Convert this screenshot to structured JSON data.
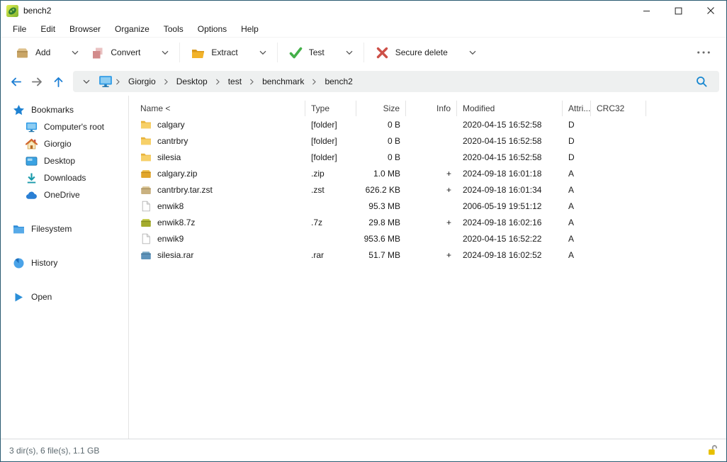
{
  "window": {
    "title": "bench2",
    "app_icon": "peazip-logo-icon",
    "controls": [
      {
        "name": "minimize",
        "icon": "minimize-icon"
      },
      {
        "name": "maximize",
        "icon": "maximize-icon"
      },
      {
        "name": "close",
        "icon": "close-icon"
      }
    ]
  },
  "menu": {
    "items": [
      "File",
      "Edit",
      "Browser",
      "Organize",
      "Tools",
      "Options",
      "Help"
    ]
  },
  "toolbar": {
    "buttons": [
      {
        "label": "Add",
        "icon": "add-archive-icon",
        "separator_after": false
      },
      {
        "label": "Convert",
        "icon": "convert-icon",
        "separator_after": true
      },
      {
        "label": "Extract",
        "icon": "extract-folder-icon",
        "separator_after": true
      },
      {
        "label": "Test",
        "icon": "test-check-icon",
        "separator_after": true
      },
      {
        "label": "Secure delete",
        "icon": "secure-delete-icon",
        "separator_after": false
      }
    ],
    "dropdown_icon": "chevron-down-icon",
    "more_icon": "ellipsis-icon"
  },
  "navbar": {
    "buttons": [
      {
        "name": "back",
        "icon": "back-arrow-icon"
      },
      {
        "name": "forward",
        "icon": "forward-arrow-icon"
      },
      {
        "name": "up",
        "icon": "up-arrow-icon"
      }
    ],
    "address_dropdown_icon": "chevron-down-icon",
    "device_icon": "computer-icon",
    "breadcrumb": [
      "Giorgio",
      "Desktop",
      "test",
      "benchmark",
      "bench2"
    ],
    "separator_icon": "chevron-right-icon",
    "search_icon": "magnifier-icon"
  },
  "sidebar": {
    "items": [
      {
        "label": "Bookmarks",
        "icon": "bookmarks-star-icon",
        "indent": 0,
        "gap": false
      },
      {
        "label": "Computer's root",
        "icon": "computer-icon",
        "indent": 1,
        "gap": false
      },
      {
        "label": "Giorgio",
        "icon": "home-icon",
        "indent": 1,
        "gap": false
      },
      {
        "label": "Desktop",
        "icon": "desktop-icon",
        "indent": 1,
        "gap": false
      },
      {
        "label": "Downloads",
        "icon": "downloads-icon",
        "indent": 1,
        "gap": false
      },
      {
        "label": "OneDrive",
        "icon": "onedrive-cloud-icon",
        "indent": 1,
        "gap": false
      },
      {
        "label": "Filesystem",
        "icon": "filesystem-folder-icon",
        "indent": 0,
        "gap": true
      },
      {
        "label": "History",
        "icon": "history-icon",
        "indent": 0,
        "gap": true
      },
      {
        "label": "Open",
        "icon": "open-icon",
        "indent": 0,
        "gap": true
      }
    ]
  },
  "table": {
    "columns": [
      {
        "label": "Name <",
        "align": "left"
      },
      {
        "label": "Type",
        "align": "left"
      },
      {
        "label": "Size",
        "align": "right"
      },
      {
        "label": "Info",
        "align": "right"
      },
      {
        "label": "Modified",
        "align": "left"
      },
      {
        "label": "Attri...",
        "align": "left"
      },
      {
        "label": "CRC32",
        "align": "left"
      }
    ],
    "rows": [
      {
        "name": "calgary",
        "icon": "folder-icon",
        "type": "[folder]",
        "size": "0 B",
        "info": "",
        "modified": "2020-04-15 16:52:58",
        "attr": "D",
        "crc32": ""
      },
      {
        "name": "cantrbry",
        "icon": "folder-icon",
        "type": "[folder]",
        "size": "0 B",
        "info": "",
        "modified": "2020-04-15 16:52:58",
        "attr": "D",
        "crc32": ""
      },
      {
        "name": "silesia",
        "icon": "folder-icon",
        "type": "[folder]",
        "size": "0 B",
        "info": "",
        "modified": "2020-04-15 16:52:58",
        "attr": "D",
        "crc32": ""
      },
      {
        "name": "calgary.zip",
        "icon": "zip-archive-icon",
        "type": ".zip",
        "size": "1.0 MB",
        "info": "+",
        "modified": "2024-09-18 16:01:18",
        "attr": "A",
        "crc32": ""
      },
      {
        "name": "cantrbry.tar.zst",
        "icon": "zst-archive-icon",
        "type": ".zst",
        "size": "626.2 KB",
        "info": "+",
        "modified": "2024-09-18 16:01:34",
        "attr": "A",
        "crc32": ""
      },
      {
        "name": "enwik8",
        "icon": "file-icon",
        "type": "",
        "size": "95.3 MB",
        "info": "",
        "modified": "2006-05-19 19:51:12",
        "attr": "A",
        "crc32": ""
      },
      {
        "name": "enwik8.7z",
        "icon": "7z-archive-icon",
        "type": ".7z",
        "size": "29.8 MB",
        "info": "+",
        "modified": "2024-09-18 16:02:16",
        "attr": "A",
        "crc32": ""
      },
      {
        "name": "enwik9",
        "icon": "file-icon",
        "type": "",
        "size": "953.6 MB",
        "info": "",
        "modified": "2020-04-15 16:52:22",
        "attr": "A",
        "crc32": ""
      },
      {
        "name": "silesia.rar",
        "icon": "rar-archive-icon",
        "type": ".rar",
        "size": "51.7 MB",
        "info": "+",
        "modified": "2024-09-18 16:02:52",
        "attr": "A",
        "crc32": ""
      }
    ]
  },
  "statusbar": {
    "summary": "3 dir(s), 6 file(s), 1.1 GB",
    "lock_icon": "unlocked-padlock-icon"
  },
  "colors": {
    "accent_blue": "#1d7fd4",
    "folder_yellow": "#f5cd5f",
    "test_green": "#44b049",
    "delete_red": "#cd5048",
    "addr_bg": "#eef0f0",
    "border": "#2a5a70"
  }
}
